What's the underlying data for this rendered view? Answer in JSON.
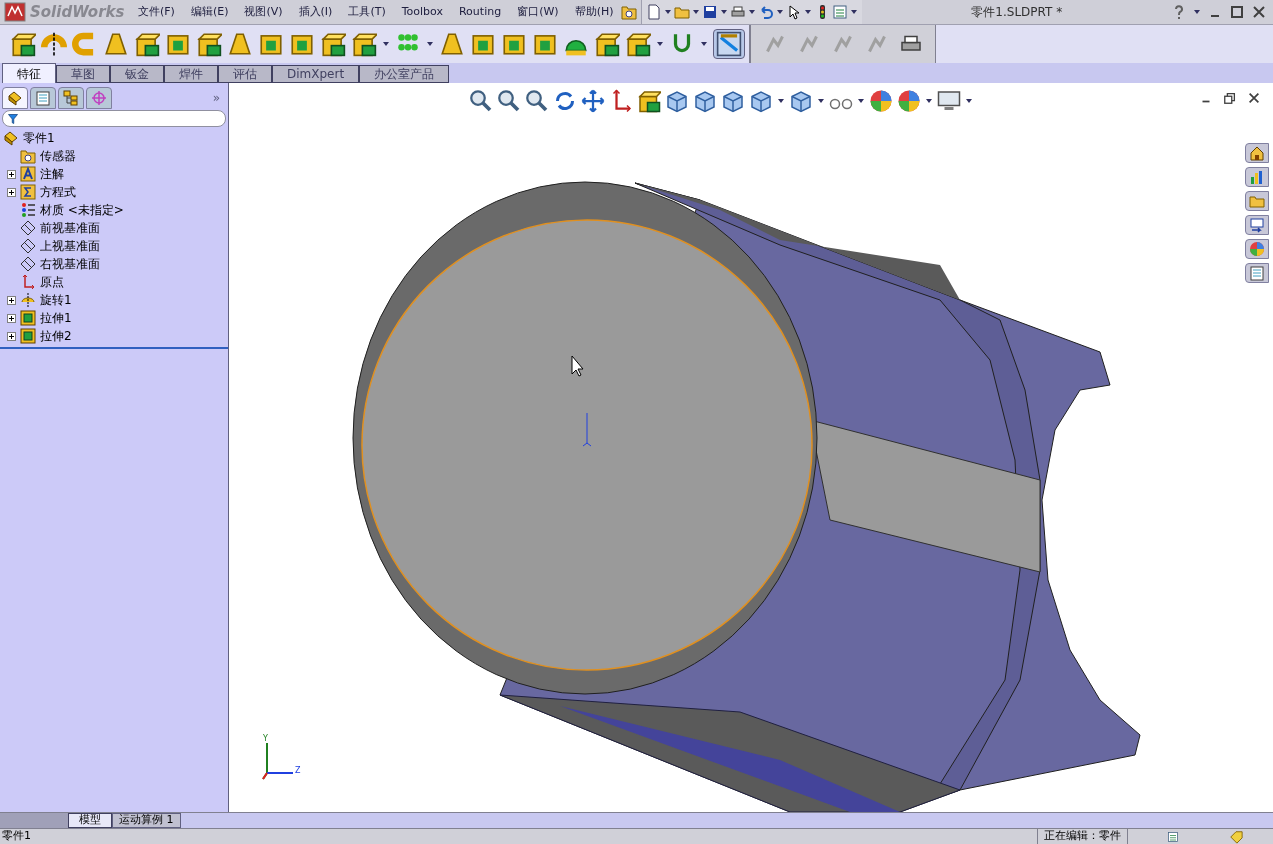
{
  "app": {
    "logo": "SolidWorks",
    "title": "零件1.SLDPRT *"
  },
  "menu": [
    "文件(F)",
    "编辑(E)",
    "视图(V)",
    "插入(I)",
    "工具(T)",
    "Toolbox",
    "Routing",
    "窗口(W)",
    "帮助(H)"
  ],
  "command_tabs": [
    {
      "label": "特征",
      "selected": true
    },
    {
      "label": "草图",
      "selected": false
    },
    {
      "label": "钣金",
      "selected": false
    },
    {
      "label": "焊件",
      "selected": false
    },
    {
      "label": "评估",
      "selected": false
    },
    {
      "label": "DimXpert",
      "selected": false
    },
    {
      "label": "办公室产品",
      "selected": false
    }
  ],
  "panel_tabs": [
    {
      "selected": true
    },
    {
      "selected": false
    },
    {
      "selected": false
    },
    {
      "selected": false
    }
  ],
  "panel_more": "»",
  "tree": {
    "label": "零件1",
    "children": [
      {
        "label": "传感器"
      },
      {
        "label": "注解",
        "expanded": false
      },
      {
        "label": "方程式",
        "expanded": false
      },
      {
        "label": "材质 <未指定>"
      },
      {
        "label": "前视基准面"
      },
      {
        "label": "上视基准面"
      },
      {
        "label": "右视基准面"
      },
      {
        "label": "原点"
      },
      {
        "label": "旋转1",
        "expanded": false
      },
      {
        "label": "拉伸1",
        "expanded": false
      },
      {
        "label": "拉伸2",
        "expanded": false
      }
    ]
  },
  "bottom_tabs": [
    {
      "label": "模型",
      "selected": true
    },
    {
      "label": "运动算例 1",
      "selected": false
    }
  ],
  "status_bar": {
    "document": "零件1",
    "mode": "正在编辑：零件"
  },
  "triad": {
    "y": "Y",
    "z": "Z"
  }
}
